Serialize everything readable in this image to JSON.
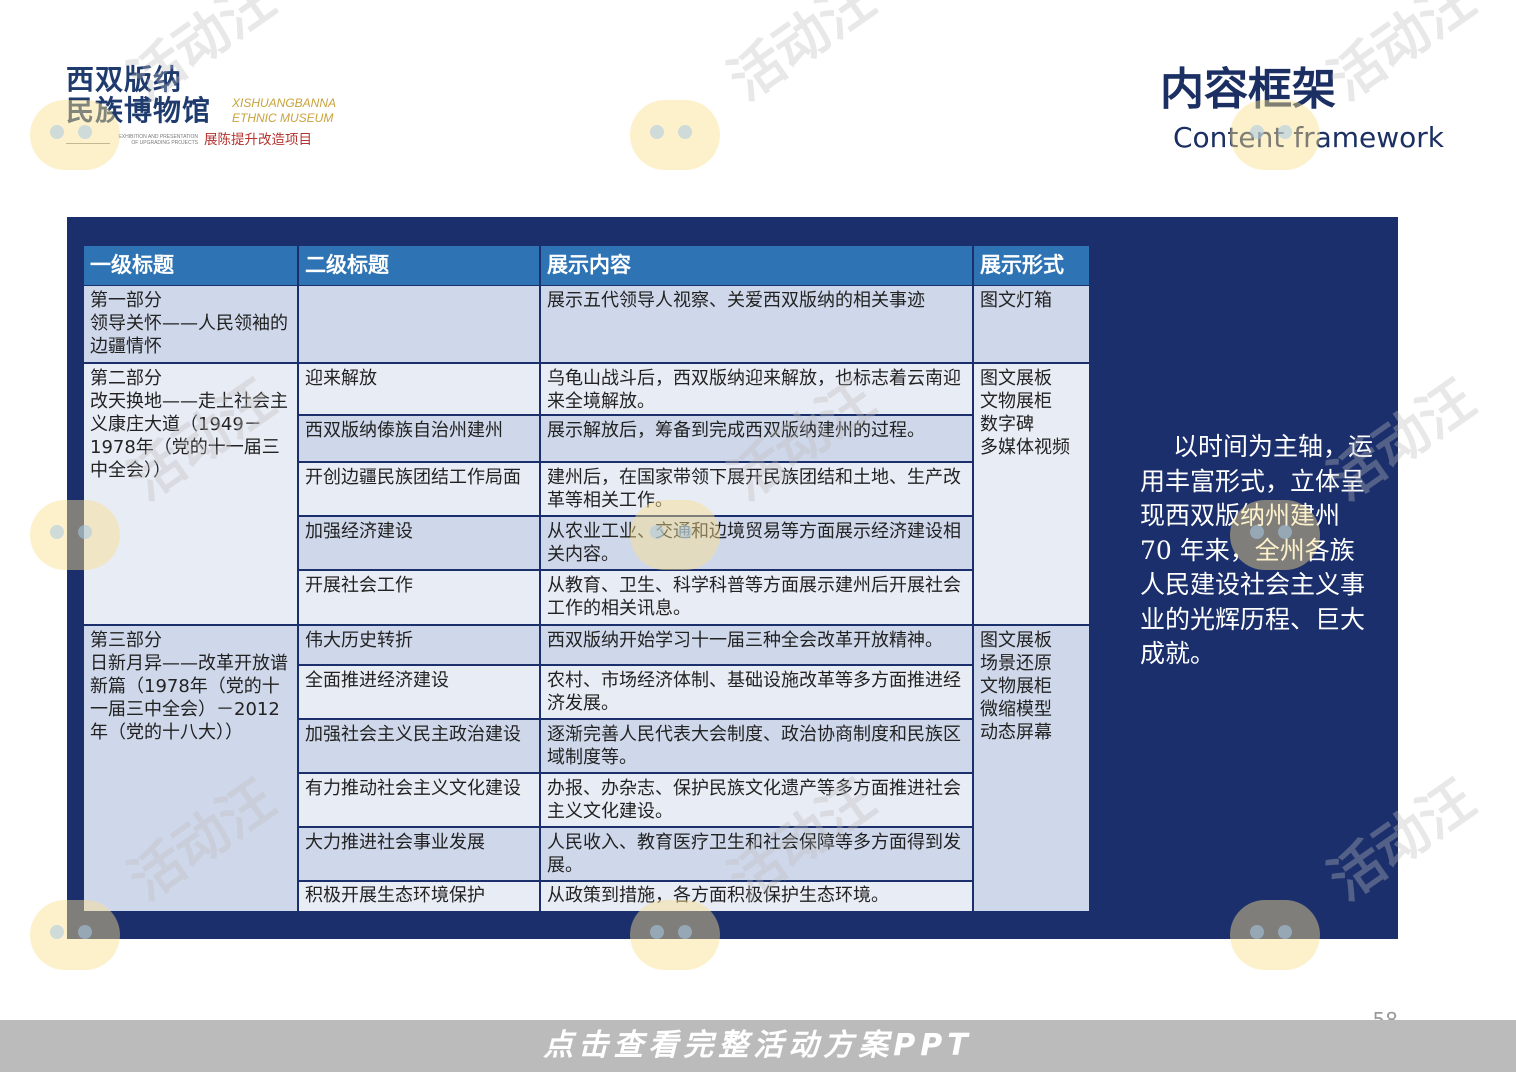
{
  "logo": {
    "cn_line1": "西双版纳",
    "cn_line2": "民族博物馆",
    "en_line1": "XISHUANGBANNA",
    "en_line2": "ETHNIC MUSEUM",
    "sub_en_line1": "EXHIBITION AND PRESENTATION",
    "sub_en_line2": "OF UPGRADING PROJECTS",
    "sub_cn": "展陈提升改造项目"
  },
  "title": {
    "cn": "内容框架",
    "en": "Content framework"
  },
  "table": {
    "headers": [
      "一级标题",
      "二级标题",
      "展示内容",
      "展示形式"
    ],
    "part1": {
      "level1": "第一部分\n领导关怀——人民领袖的边疆情怀",
      "level2": "",
      "content": "展示五代领导人视察、关爱西双版纳的相关事迹",
      "form": "图文灯箱"
    },
    "part2": {
      "level1": "第二部分\n改天换地——走上社会主义康庄大道（1949－1978年（党的十一届三中全会））",
      "form": "图文展板\n文物展柜\n数字碑\n多媒体视频",
      "rows": [
        {
          "level2": "迎来解放",
          "content": "乌龟山战斗后，西双版纳迎来解放，也标志着云南迎来全境解放。"
        },
        {
          "level2": "西双版纳傣族自治州建州",
          "content": "展示解放后，筹备到完成西双版纳建州的过程。"
        },
        {
          "level2": "开创边疆民族团结工作局面",
          "content": "建州后，在国家带领下展开民族团结和土地、生产改革等相关工作。"
        },
        {
          "level2": "加强经济建设",
          "content": "从农业工业、交通和边境贸易等方面展示经济建设相关内容。"
        },
        {
          "level2": "开展社会工作",
          "content": "从教育、卫生、科学科普等方面展示建州后开展社会工作的相关讯息。"
        }
      ]
    },
    "part3": {
      "level1": "第三部分\n日新月异——改革开放谱新篇（1978年（党的十一届三中全会）－2012年（党的十八大））",
      "form": "图文展板\n场景还原\n文物展柜\n微缩模型\n动态屏幕",
      "rows": [
        {
          "level2": "伟大历史转折",
          "content": "西双版纳开始学习十一届三种全会改革开放精神。"
        },
        {
          "level2": "全面推进经济建设",
          "content": "农村、市场经济体制、基础设施改革等多方面推进经济发展。"
        },
        {
          "level2": "加强社会主义民主政治建设",
          "content": "逐渐完善人民代表大会制度、政治协商制度和民族区域制度等。"
        },
        {
          "level2": "有力推动社会主义文化建设",
          "content": "办报、办杂志、保护民族文化遗产等多方面推进社会主义文化建设。"
        },
        {
          "level2": "大力推进社会事业发展",
          "content": "人民收入、教育医疗卫生和社会保障等多方面得到发展。"
        },
        {
          "level2": "积极开展生态环境保护",
          "content": "从政策到措施，各方面积极保护生态环境。"
        }
      ]
    }
  },
  "side_text": "以时间为主轴，运用丰富形式，立体呈现西双版纳州建州 70 年来，全州各族人民建设社会主义事业的光辉历程、巨大成就。",
  "page_number": "58",
  "bottom_banner": "点击查看完整活动方案PPT",
  "watermark_text": "活动汪"
}
